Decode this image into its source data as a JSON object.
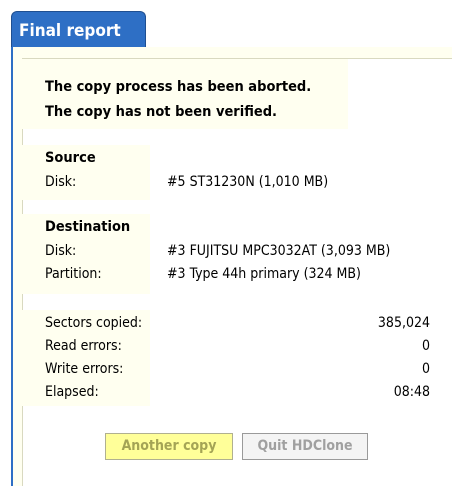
{
  "tab": {
    "title": "Final report"
  },
  "message": {
    "line1": "The copy process has been aborted.",
    "line2": "The copy has not been verified."
  },
  "source": {
    "heading": "Source",
    "disk_label": "Disk:",
    "disk_value": "#5 ST31230N (1,010 MB)"
  },
  "destination": {
    "heading": "Destination",
    "disk_label": "Disk:",
    "disk_value": "#3 FUJITSU MPC3032AT (3,093 MB)",
    "partition_label": "Partition:",
    "partition_value": "#3 Type 44h primary (324 MB)"
  },
  "stats": [
    {
      "label": "Sectors copied:",
      "value": "385,024"
    },
    {
      "label": "Read errors:",
      "value": "0"
    },
    {
      "label": "Write errors:",
      "value": "0"
    },
    {
      "label": "Elapsed:",
      "value": "08:48"
    }
  ],
  "buttons": {
    "another_copy": "Another copy",
    "quit": "Quit HDClone"
  },
  "colors": {
    "accent": "#2e6fc5",
    "panel_bg": "#fffff0",
    "primary_button": "#ffff99"
  }
}
